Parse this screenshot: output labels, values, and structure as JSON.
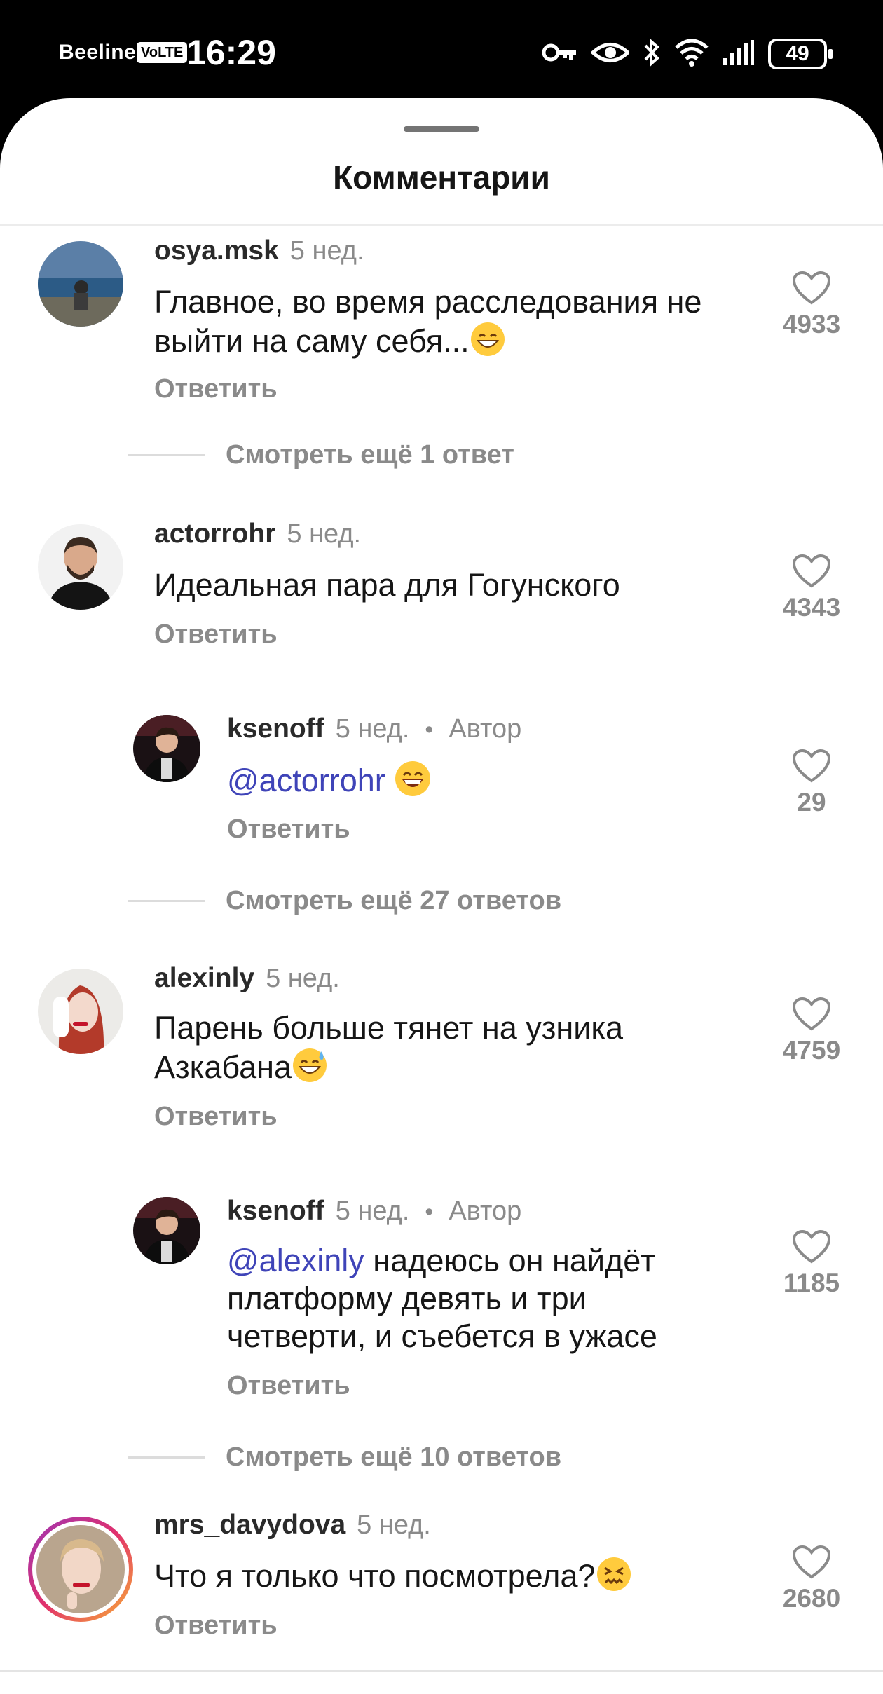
{
  "status": {
    "carrier": "Beeline",
    "volte": "VoLTE",
    "time": "16:29",
    "battery": "49"
  },
  "sheet": {
    "title": "Комментарии"
  },
  "comments": [
    {
      "username": "osya.msk",
      "time": "5 нед.",
      "text": "Главное, во время расследования не\nвыйти на саму себя...",
      "emoji": "😁",
      "reply": "Ответить",
      "likes": "4933",
      "more": "Смотреть ещё 1 ответ"
    },
    {
      "username": "actorrohr",
      "time": "5 нед.",
      "text": "Идеальная пара для Гогунского",
      "reply": "Ответить",
      "likes": "4343"
    },
    {
      "username": "ksenoff",
      "time": "5 нед.",
      "author": "Автор",
      "mention": "@actorrohr",
      "emoji": "😄",
      "reply": "Ответить",
      "likes": "29",
      "more": "Смотреть ещё 27 ответов"
    },
    {
      "username": "alexinly",
      "time": "5 нед.",
      "text": "Парень больше тянет на узника\nАзкабана",
      "emoji": "😅",
      "reply": "Ответить",
      "likes": "4759"
    },
    {
      "username": "ksenoff",
      "time": "5 нед.",
      "author": "Автор",
      "mention": "@alexinly",
      "text": " надеюсь он найдёт\nплатформу девять и три\nчетверти, и съебется в ужасе",
      "reply": "Ответить",
      "likes": "1185",
      "more": "Смотреть ещё 10 ответов"
    },
    {
      "username": "mrs_davydova",
      "time": "5 нед.",
      "text": "Что я только что посмотрела?",
      "emoji": "😖",
      "reply": "Ответить",
      "likes": "2680"
    }
  ],
  "colors": {
    "mention": "#3f44b8",
    "muted": "#8a8a8a",
    "story_ring": [
      "#f9b233",
      "#e1306c",
      "#9b36b7"
    ]
  }
}
